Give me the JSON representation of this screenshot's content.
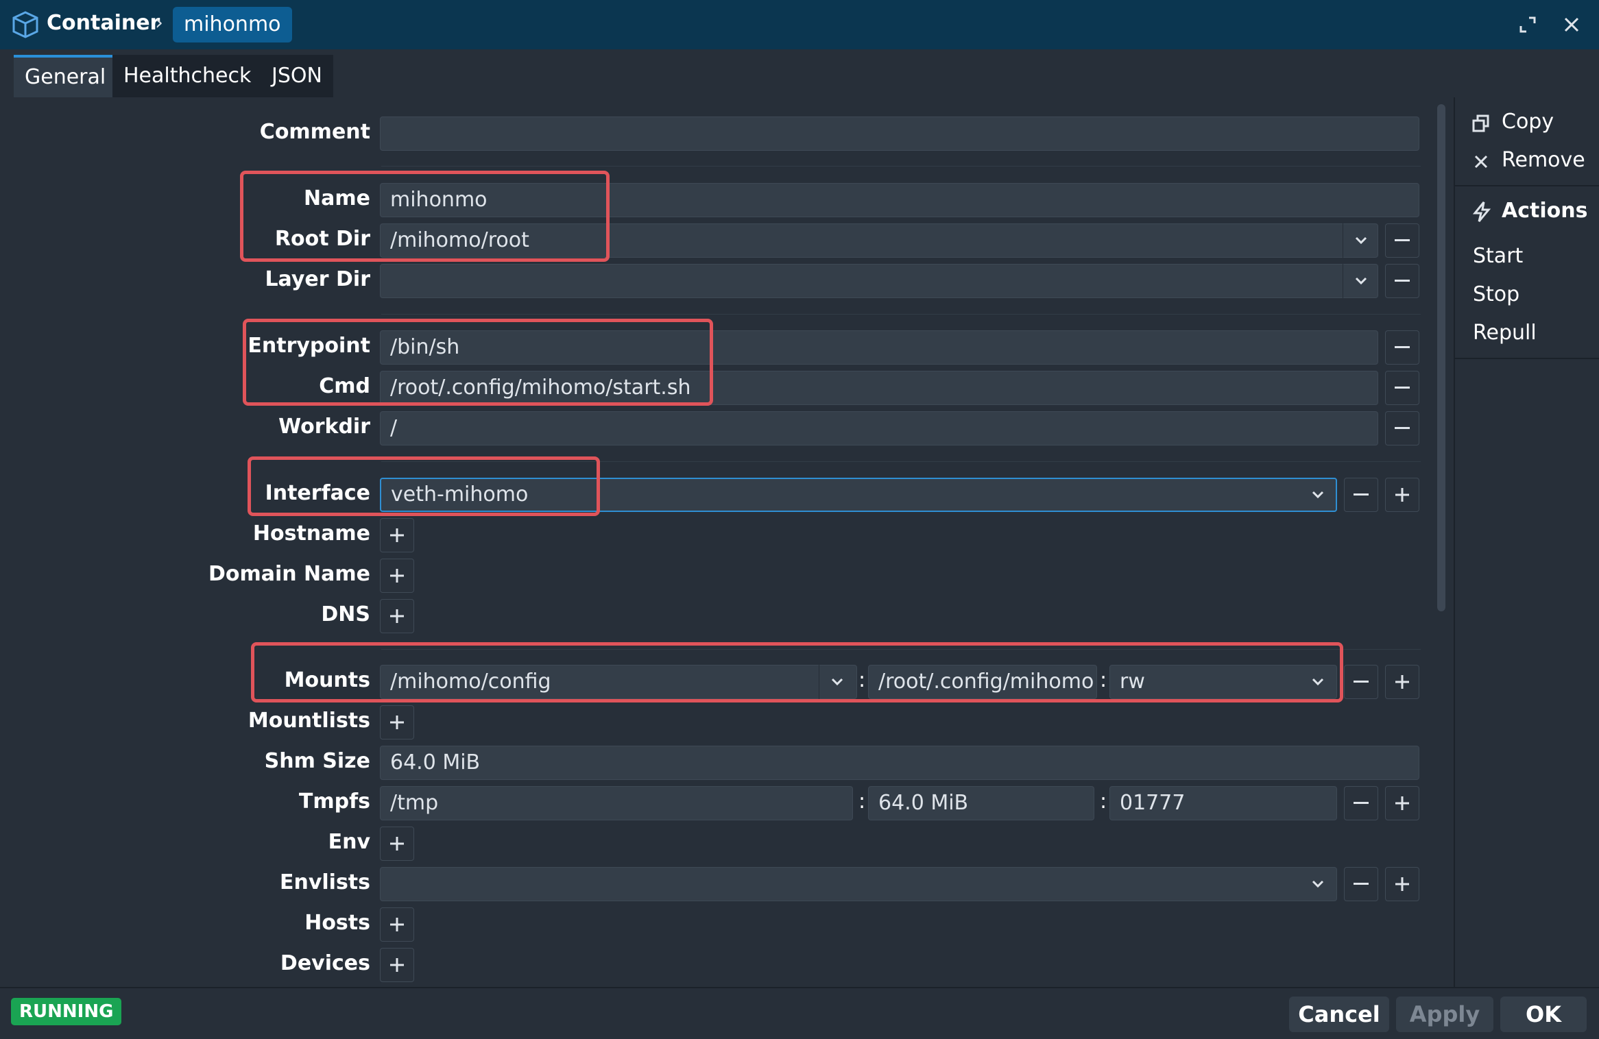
{
  "window": {
    "breadcrumb_root": "Container",
    "breadcrumb_sep": "›",
    "container_name": "mihonmo",
    "icons": {
      "app": "package-box-icon",
      "expand": "expand-icon",
      "close": "close-icon"
    }
  },
  "tabs": [
    {
      "label": "General",
      "active": true
    },
    {
      "label": "Healthcheck",
      "active": false
    },
    {
      "label": "JSON",
      "active": false
    }
  ],
  "form": {
    "comment": {
      "label": "Comment",
      "value": ""
    },
    "name": {
      "label": "Name",
      "value": "mihonmo"
    },
    "root_dir": {
      "label": "Root Dir",
      "value": "/mihomo/root"
    },
    "layer_dir": {
      "label": "Layer Dir",
      "value": ""
    },
    "entrypoint": {
      "label": "Entrypoint",
      "value": "/bin/sh"
    },
    "cmd": {
      "label": "Cmd",
      "value": "/root/.config/mihomo/start.sh"
    },
    "workdir": {
      "label": "Workdir",
      "value": "/"
    },
    "interface": {
      "label": "Interface",
      "value": "veth-mihomo"
    },
    "hostname": {
      "label": "Hostname"
    },
    "domain_name": {
      "label": "Domain Name"
    },
    "dns": {
      "label": "DNS"
    },
    "mounts": {
      "label": "Mounts",
      "source": "/mihomo/config",
      "target": "/root/.config/mihomo",
      "mode": "rw"
    },
    "mountlists": {
      "label": "Mountlists"
    },
    "shm_size": {
      "label": "Shm Size",
      "value": "64.0 MiB"
    },
    "tmpfs": {
      "label": "Tmpfs",
      "path": "/tmp",
      "size": "64.0 MiB",
      "mode": "01777"
    },
    "env": {
      "label": "Env"
    },
    "envlists": {
      "label": "Envlists",
      "value": ""
    },
    "hosts": {
      "label": "Hosts"
    },
    "devices": {
      "label": "Devices"
    },
    "separator": ":"
  },
  "sidebar": {
    "copy": "Copy",
    "remove": "Remove",
    "actions_title": "Actions",
    "actions": [
      "Start",
      "Stop",
      "Repull"
    ]
  },
  "status": {
    "state": "RUNNING",
    "state_color": "#1aa453"
  },
  "footer": {
    "cancel": "Cancel",
    "apply": "Apply",
    "ok": "OK"
  },
  "colors": {
    "titlebar": "#0b3650",
    "accent": "#2a8fd8",
    "highlight": "#e0545a",
    "panel": "#272f39"
  }
}
